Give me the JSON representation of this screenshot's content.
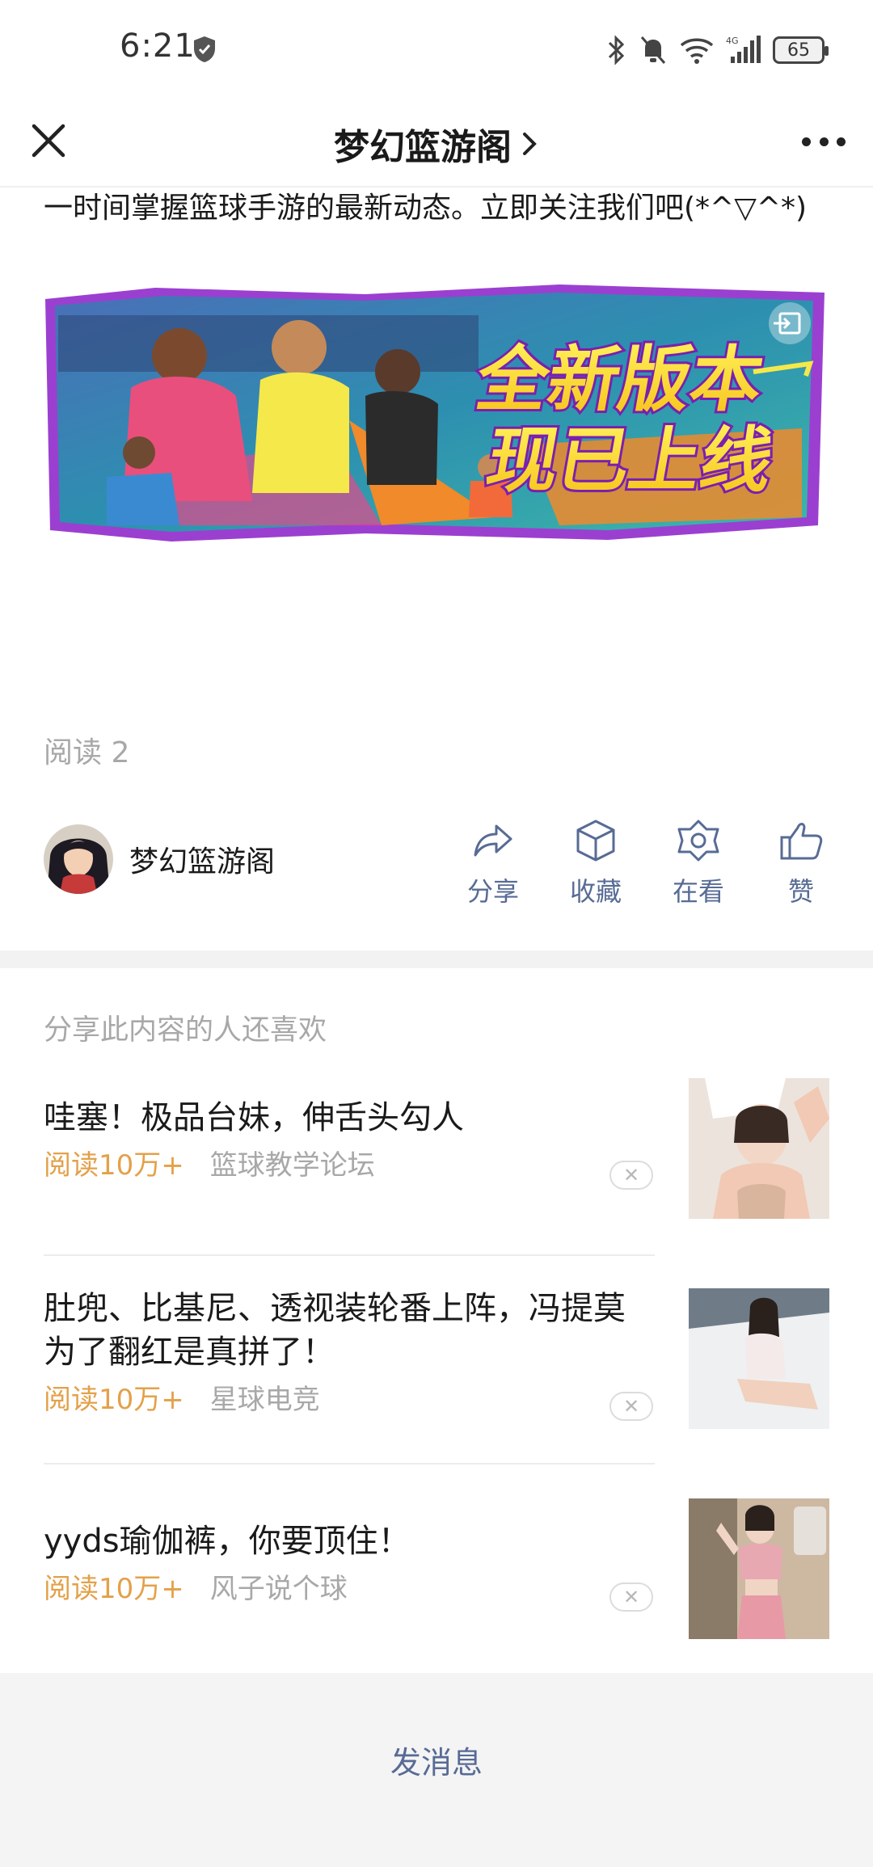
{
  "status_bar": {
    "time": "6:21",
    "network": "4G",
    "battery": "65"
  },
  "nav": {
    "title": "梦幻篮游阁",
    "icons": [
      "close-icon",
      "chevron-right-icon",
      "more-icon"
    ]
  },
  "article": {
    "intro_text": "一时间掌握篮球手游的最新动态。立即关注我们吧(*^▽^*)",
    "banner_line1": "全新版本",
    "banner_line2": "现已上线",
    "read_count": "阅读 2"
  },
  "author": {
    "name": "梦幻篮游阁"
  },
  "actions": [
    {
      "label": "分享",
      "icon": "share-icon"
    },
    {
      "label": "收藏",
      "icon": "favorite-box-icon"
    },
    {
      "label": "在看",
      "icon": "wow-icon"
    },
    {
      "label": "赞",
      "icon": "thumbs-up-icon"
    }
  ],
  "recommendations": {
    "section_title": "分享此内容的人还喜欢",
    "items": [
      {
        "headline": "哇塞！极品台妹，伸舌头勾人",
        "reads": "阅读10万+",
        "source": "篮球教学论坛"
      },
      {
        "headline": "肚兜、比基尼、透视装轮番上阵，冯提莫为了翻红是真拼了！",
        "reads": "阅读10万+",
        "source": "星球电竞"
      },
      {
        "headline": "yyds瑜伽裤，你要顶住！",
        "reads": "阅读10万+",
        "source": "风子说个球"
      }
    ]
  },
  "bottom": {
    "send_message": "发消息"
  },
  "colors": {
    "link_blue": "#576b95",
    "reads_orange": "#e3a14a",
    "muted_gray": "#a8a8a8"
  }
}
